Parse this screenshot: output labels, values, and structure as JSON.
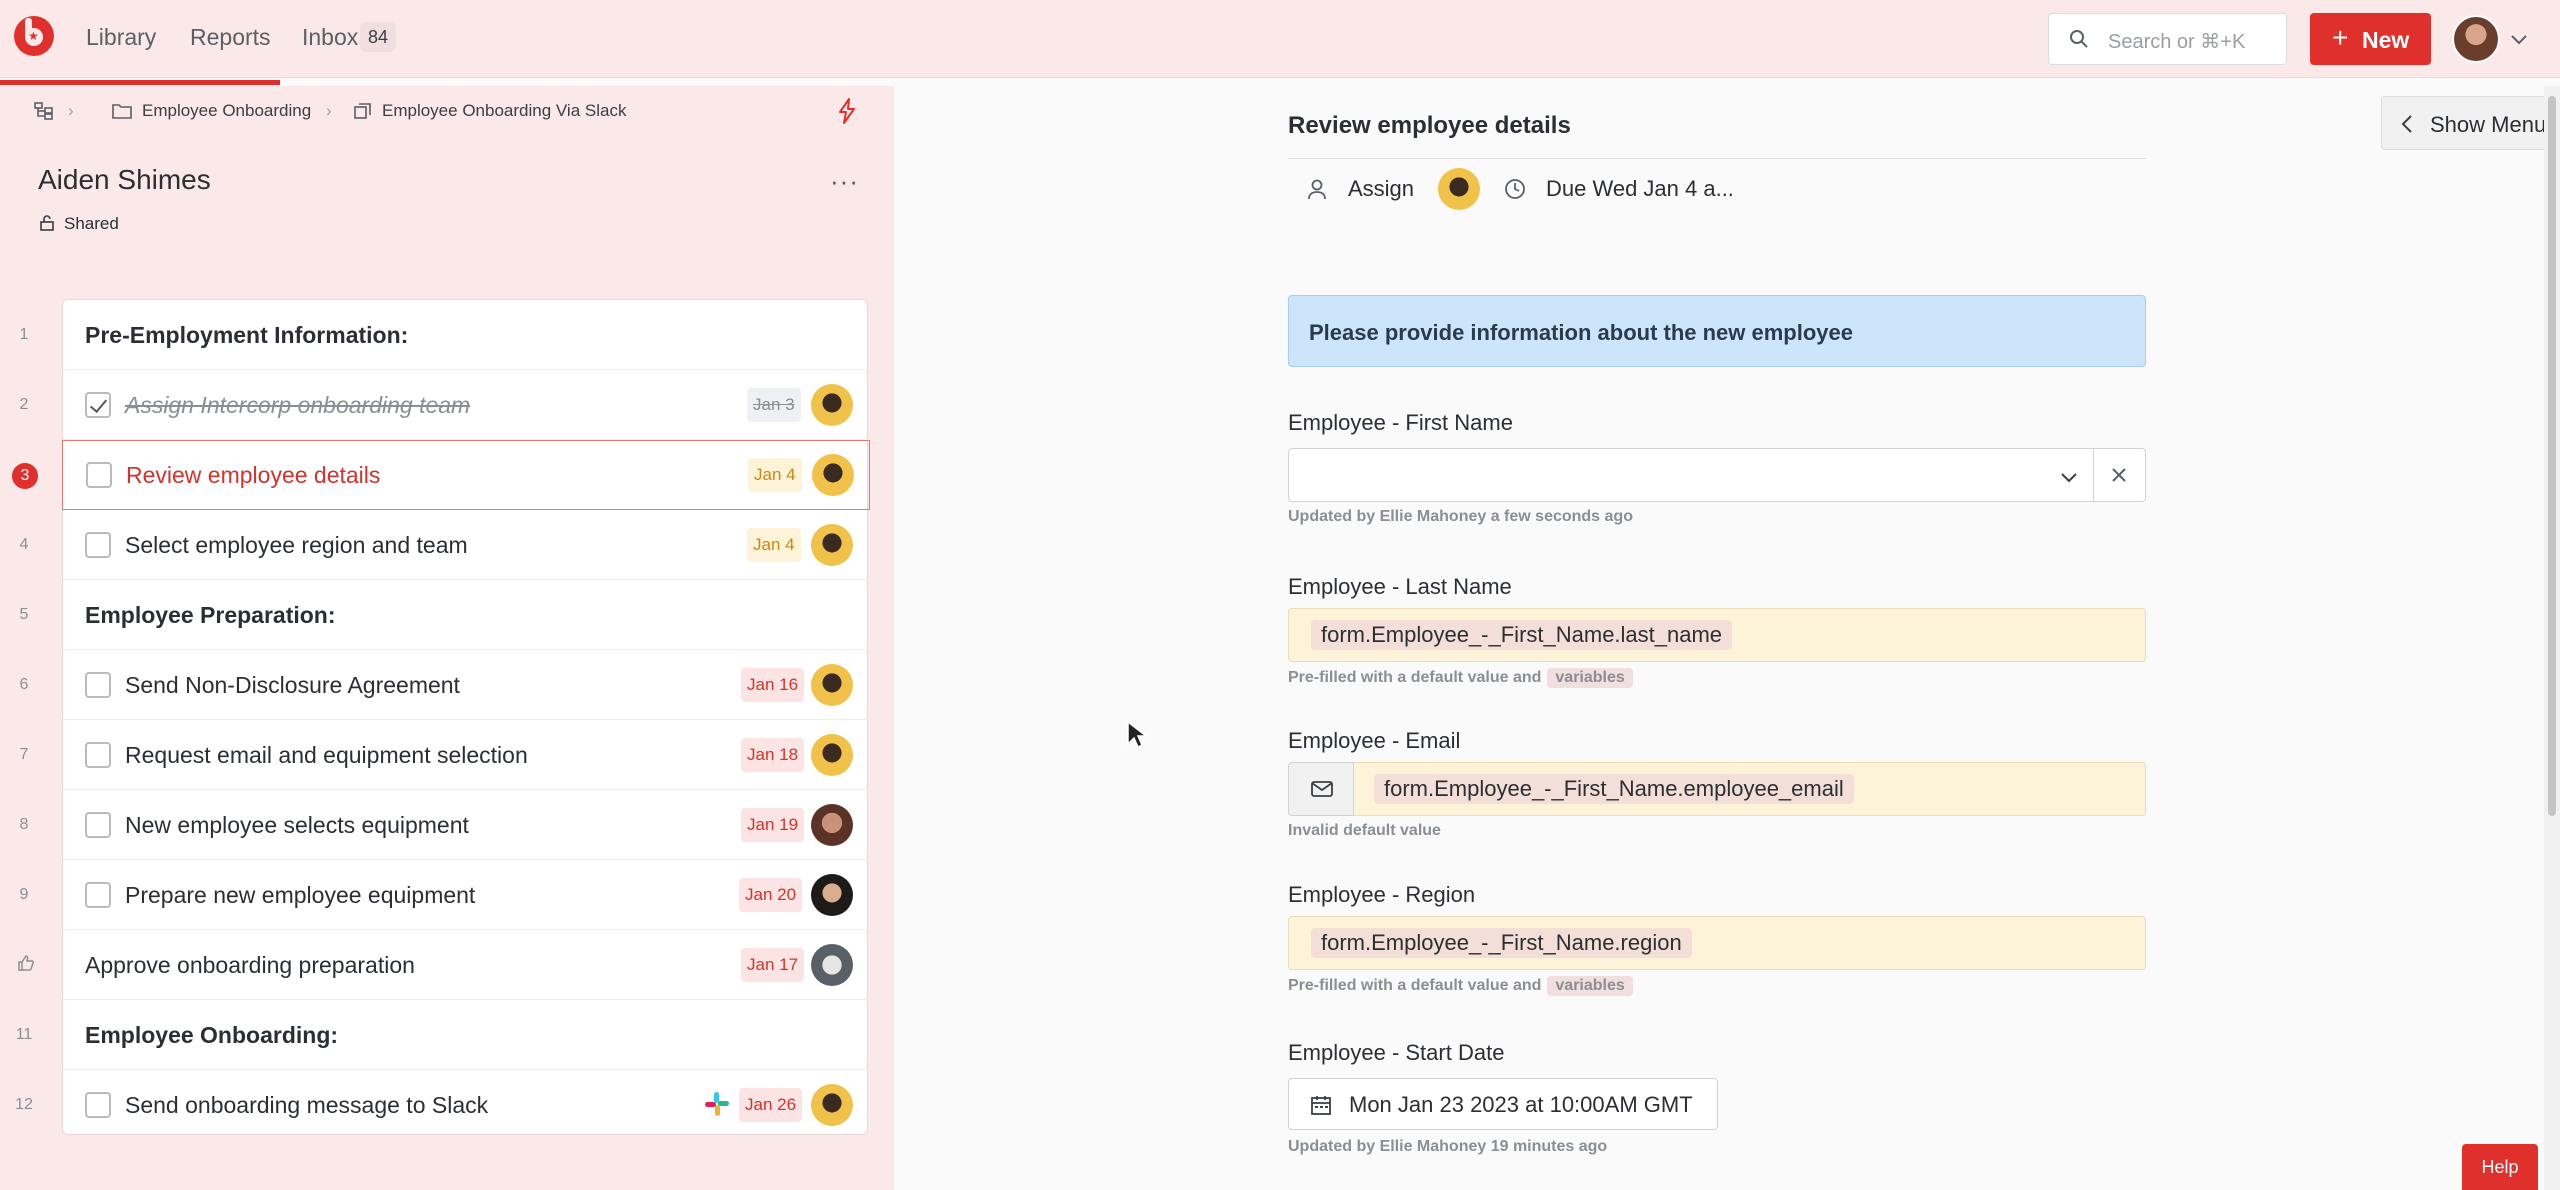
{
  "topbar": {
    "nav": [
      "Library",
      "Reports",
      "Inbox"
    ],
    "inbox_count": "84",
    "search_placeholder": "Search or ⌘+K",
    "new_label": "New"
  },
  "breadcrumb": [
    "Employee Onboarding",
    "Employee Onboarding Via Slack"
  ],
  "run": {
    "title": "Aiden Shimes",
    "visibility": "Shared"
  },
  "tasks": [
    {
      "num": "1",
      "kind": "heading",
      "text": "Pre-Employment Information:"
    },
    {
      "num": "2",
      "kind": "task",
      "text": "Assign Intercorp onboarding team",
      "due": "Jan 3",
      "status": "done"
    },
    {
      "num": "3",
      "kind": "task",
      "text": "Review employee details",
      "due": "Jan 4",
      "status": "active"
    },
    {
      "num": "4",
      "kind": "task",
      "text": "Select employee region and team",
      "due": "Jan 4"
    },
    {
      "num": "5",
      "kind": "heading",
      "text": "Employee Preparation:"
    },
    {
      "num": "6",
      "kind": "task",
      "text": "Send Non-Disclosure Agreement",
      "due": "Jan 16"
    },
    {
      "num": "7",
      "kind": "task",
      "text": "Request email and equipment selection",
      "due": "Jan 18"
    },
    {
      "num": "8",
      "kind": "task",
      "text": "New employee selects equipment",
      "due": "Jan 19"
    },
    {
      "num": "9",
      "kind": "task",
      "text": "Prepare new employee equipment",
      "due": "Jan 20"
    },
    {
      "num": "",
      "kind": "approval",
      "text": "Approve onboarding preparation",
      "due": "Jan 17"
    },
    {
      "num": "11",
      "kind": "heading",
      "text": "Employee Onboarding:"
    },
    {
      "num": "12",
      "kind": "task",
      "text": "Send onboarding message to Slack",
      "due": "Jan 26"
    }
  ],
  "detail": {
    "title": "Review employee details",
    "assign_label": "Assign",
    "due_label": "Due Wed Jan 4 a...",
    "banner": "Please provide information about the new employee",
    "fields": {
      "first_name": {
        "label": "Employee - First Name",
        "note": "Updated by Ellie Mahoney a few seconds ago"
      },
      "last_name": {
        "label": "Employee - Last Name",
        "value": "form.Employee_-_First_Name.last_name",
        "note": "Pre-filled with a default value and",
        "chip": "variables"
      },
      "email": {
        "label": "Employee - Email",
        "value": "form.Employee_-_First_Name.employee_email",
        "note": "Invalid default value"
      },
      "region": {
        "label": "Employee - Region",
        "value": "form.Employee_-_First_Name.region",
        "note": "Pre-filled with a default value and",
        "chip": "variables"
      },
      "start_date": {
        "label": "Employee - Start Date",
        "value": "Mon Jan 23 2023 at 10:00AM GMT",
        "note": "Updated by Ellie Mahoney 19 minutes ago"
      }
    }
  },
  "show_menu": "Show Menu",
  "help": "Help",
  "colors": {
    "brand": "#e0302c",
    "panel": "#fbe9e9",
    "banner": "#cde5fa",
    "prefill": "#fdf3d8"
  }
}
